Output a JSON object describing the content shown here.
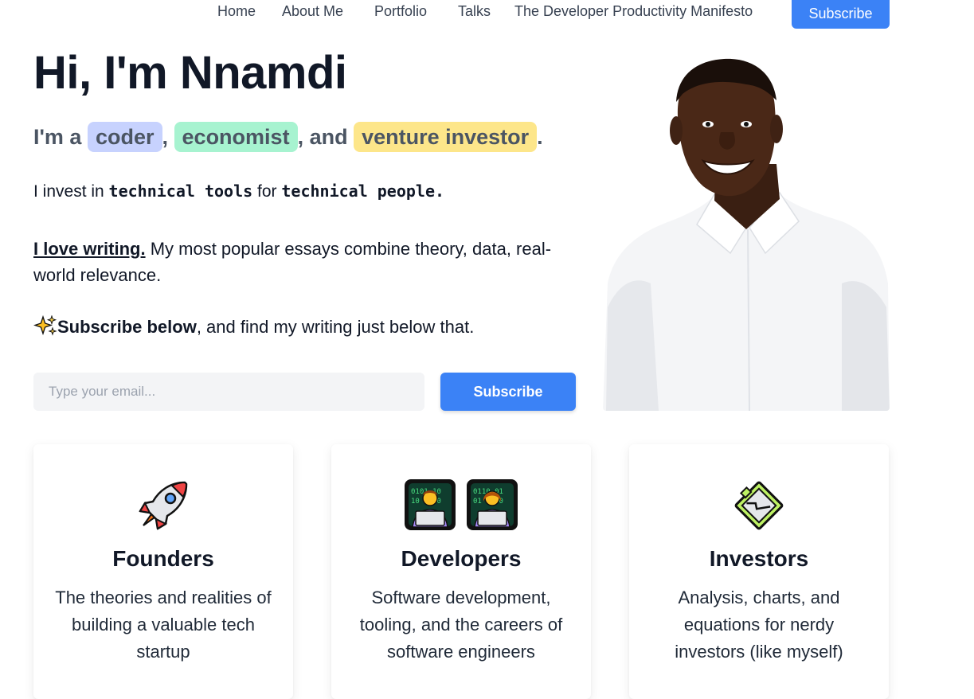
{
  "nav": {
    "items": [
      {
        "label": "Home"
      },
      {
        "label": "About Me"
      },
      {
        "label": "Portfolio"
      },
      {
        "label": "Talks"
      },
      {
        "label": "The Developer Productivity Manifesto"
      }
    ],
    "subscribe_label": "Subscribe"
  },
  "hero": {
    "title": "Hi, I'm Nnamdi",
    "tagline": {
      "prefix": "I'm a",
      "role1": "coder",
      "sep1": ",",
      "role2": "economist",
      "sep2": ", and",
      "role3": "venture investor",
      "suffix": "."
    },
    "invest": {
      "part1": "I invest in ",
      "bold1": "technical tools",
      "part2": " for ",
      "bold2": "technical people."
    },
    "writing": {
      "link": "I love writing.",
      "rest": " My most popular essays combine theory, data, real-world relevance."
    },
    "subscribe_line": {
      "bold": "Subscribe below",
      "rest": ", and find my writing just below that."
    },
    "email_placeholder": "Type your email...",
    "email_button": "Subscribe"
  },
  "cards": [
    {
      "icon": "rocket-icon",
      "title": "Founders",
      "body": "The theories and realities of building a valuable tech startup"
    },
    {
      "icon": "technologist-icons",
      "title": "Developers",
      "body": "Software development, tooling, and the careers of software engineers"
    },
    {
      "icon": "chart-paper-icon",
      "title": "Investors",
      "body": "Analysis, charts, and equations for nerdy investors (like myself)"
    }
  ],
  "colors": {
    "accent": "#3b82f6",
    "chip_coder": "#c7d2fe",
    "chip_economist": "#a7f3d0",
    "chip_investor": "#fde68a"
  }
}
